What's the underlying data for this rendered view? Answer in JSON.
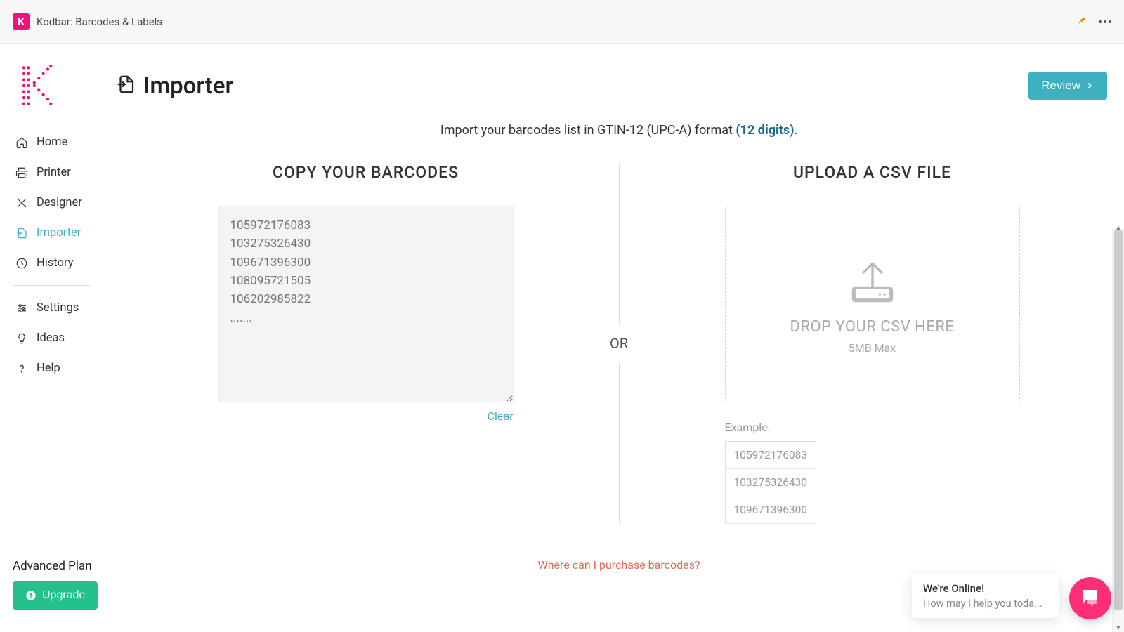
{
  "titlebar": {
    "app_name": "Kodbar: Barcodes & Labels",
    "app_icon_letter": "K"
  },
  "header": {
    "page_title": "Importer",
    "review_label": "Review"
  },
  "sidebar": {
    "items": [
      {
        "label": "Home"
      },
      {
        "label": "Printer"
      },
      {
        "label": "Designer"
      },
      {
        "label": "Importer"
      },
      {
        "label": "History"
      },
      {
        "label": "Settings"
      },
      {
        "label": "Ideas"
      },
      {
        "label": "Help"
      }
    ],
    "plan_label": "Advanced Plan",
    "upgrade_label": "Upgrade"
  },
  "main": {
    "intro_prefix": "Import your barcodes list in GTIN-12 (UPC-A) format ",
    "intro_link": "(12 digits)",
    "intro_suffix": ".",
    "copy_title": "COPY YOUR BARCODES",
    "upload_title": "UPLOAD A CSV FILE",
    "or_label": "OR",
    "textarea_placeholder": "105972176083\n103275326430\n109671396300\n108095721505\n106202985822\n.......",
    "clear_label": "Clear",
    "drop_label": "DROP YOUR CSV HERE",
    "drop_sub": "5MB Max",
    "example_label": "Example:",
    "example_rows": [
      "105972176083",
      "103275326430",
      "109671396300"
    ],
    "purchase_link": "Where can I purchase barcodes?"
  },
  "chat": {
    "header": "We're Online!",
    "sub": "How may I help you toda..."
  },
  "colors": {
    "accent_teal": "#3eb0c0",
    "accent_green": "#24c28a",
    "accent_pink": "#ff2d7a",
    "brand_magenta": "#e9157a"
  }
}
